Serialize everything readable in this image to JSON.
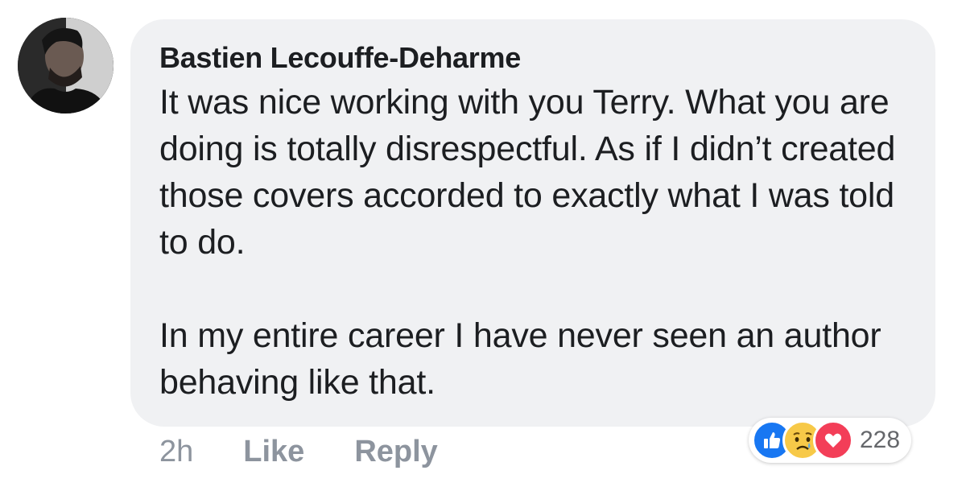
{
  "comment": {
    "author": "Bastien Lecouffe-Deharme",
    "paragraphs": [
      "It was nice working with you Terry. What you are doing is totally disrespectful. As if I didn’t created those covers accorded to exactly what I was told to do.",
      "In my entire career I have never seen an author behaving like that."
    ],
    "timestamp": "2h",
    "like_label": "Like",
    "reply_label": "Reply"
  },
  "reactions": {
    "icons": [
      "like-icon",
      "sad-icon",
      "love-icon"
    ],
    "count": "228"
  },
  "colors": {
    "bubble_background": "#f0f1f3",
    "text": "#1c1e21",
    "meta_text": "#8d949e",
    "like_blue": "#1877f2",
    "sad_yellow": "#f7c948",
    "love_red": "#f33e58"
  }
}
